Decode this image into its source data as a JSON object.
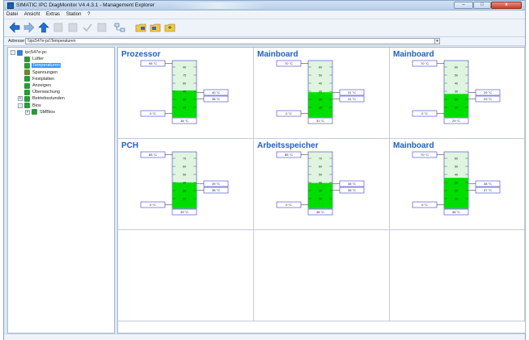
{
  "window": {
    "title": "SIMATIC IPC DiagMonitor V4.4.3.1 - Management Explorer",
    "buttons": {
      "minimize": "–",
      "maximize": "□",
      "close": "x"
    }
  },
  "menu": [
    "Datei",
    "Ansicht",
    "Extras",
    "Station",
    "?"
  ],
  "toolbar": {
    "icons": [
      "back-arrow-icon",
      "forward-arrow-icon",
      "up-arrow-icon",
      "disabled-icon",
      "disabled-icon",
      "check-icon",
      "disabled-icon",
      "network-icon",
      "folder-icon",
      "folder-icon",
      "folder-icon"
    ]
  },
  "address": {
    "label": "Adresse",
    "value": "\\\\ipc547e-pc\\Temperaturen"
  },
  "tree": [
    {
      "label": "ipc547e-pc",
      "level": 0,
      "exp": "-",
      "color": "#3a7fd0"
    },
    {
      "label": "Lüfter",
      "level": 1,
      "exp": "",
      "color": "#2a9a3a"
    },
    {
      "label": "Temperaturen",
      "level": 1,
      "exp": "",
      "color": "#2a9a3a",
      "selected": true
    },
    {
      "label": "Spannungen",
      "level": 1,
      "exp": "",
      "color": "#6a8a2a"
    },
    {
      "label": "Festplatten",
      "level": 1,
      "exp": "",
      "color": "#2a9a3a"
    },
    {
      "label": "Anzeigen",
      "level": 1,
      "exp": "",
      "color": "#2a9a3a"
    },
    {
      "label": "Überwachung",
      "level": 1,
      "exp": "",
      "color": "#2a9a3a"
    },
    {
      "label": "Betriebsstunden",
      "level": 1,
      "exp": "+",
      "color": "#2a9a3a"
    },
    {
      "label": "Bios",
      "level": 1,
      "exp": "-",
      "color": "#2a9a3a"
    },
    {
      "label": "SMBios",
      "level": 2,
      "exp": "+",
      "color": "#2a9a3a"
    }
  ],
  "panels": [
    {
      "title": "Prozessor",
      "max": "95 °C",
      "min": "0 °C",
      "current": "38 °C",
      "warn_hi": "40 °C",
      "warn_lo": "38 °C",
      "scale": [
        "90",
        "75",
        "60",
        "45",
        "30",
        "15"
      ],
      "level": 0.47
    },
    {
      "title": "Mainboard",
      "max": "70 °C",
      "min": "0 °C",
      "current": "31 °C",
      "warn_hi": "31 °C",
      "warn_lo": "31 °C",
      "scale": [
        "60",
        "50",
        "40",
        "30",
        "20",
        "10"
      ],
      "level": 0.44
    },
    {
      "title": "Mainboard",
      "max": "70 °C",
      "min": "0 °C",
      "current": "29 °C",
      "warn_hi": "29 °C",
      "warn_lo": "29 °C",
      "scale": [
        "60",
        "50",
        "40",
        "30",
        "20",
        "10"
      ],
      "level": 0.41
    },
    {
      "title": "PCH",
      "max": "85 °C",
      "min": "0 °C",
      "current": "39 °C",
      "warn_hi": "39 °C",
      "warn_lo": "38 °C",
      "scale": [
        "70",
        "60",
        "50",
        "40",
        "30",
        "20"
      ],
      "level": 0.46
    },
    {
      "title": "Arbeitsspeicher",
      "max": "85 °C",
      "min": "0 °C",
      "current": "38 °C",
      "warn_hi": "38 °C",
      "warn_lo": "38 °C",
      "scale": [
        "70",
        "60",
        "50",
        "40",
        "30",
        "20"
      ],
      "level": 0.45
    },
    {
      "title": "Mainboard",
      "max": "70 °C",
      "min": "0 °C",
      "current": "38 °C",
      "warn_hi": "38 °C",
      "warn_lo": "37 °C",
      "scale": [
        "60",
        "50",
        "40",
        "30",
        "20",
        "10"
      ],
      "level": 0.54
    },
    {
      "title": "",
      "empty": true
    },
    {
      "title": "",
      "empty": true
    },
    {
      "title": "",
      "empty": true
    }
  ],
  "colors": {
    "accent": "#1f5fc7",
    "gauge_fill": "#00dd00",
    "gauge_bg": "#dff5df",
    "box_border": "#3b3bd0"
  }
}
